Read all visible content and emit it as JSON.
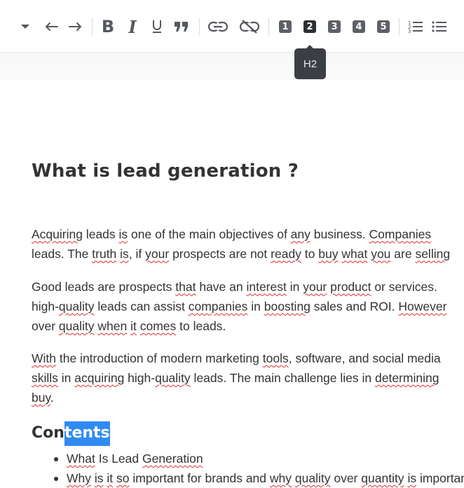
{
  "toolbar": {
    "buttons": [
      "dropdown-caret",
      "undo",
      "redo",
      "bold",
      "italic",
      "underline",
      "blockquote",
      "insert-link",
      "remove-link",
      "heading-1",
      "heading-2",
      "heading-3",
      "heading-4",
      "heading-5",
      "ordered-list",
      "bullet-list"
    ],
    "headings": [
      "1",
      "2",
      "3",
      "4",
      "5"
    ],
    "active_heading": "2",
    "tooltip": "H2"
  },
  "document": {
    "title": "What is lead generation ?",
    "p1_l1": [
      {
        "t": "Acquiring",
        "s": true
      },
      {
        "t": " leads "
      },
      {
        "t": "is",
        "s": true
      },
      {
        "t": " one of the main objectives of "
      },
      {
        "t": "any",
        "s": true
      },
      {
        "t": " business. "
      },
      {
        "t": "Companies",
        "s": true
      }
    ],
    "p1_l2": [
      {
        "t": "leads. The "
      },
      {
        "t": "truth",
        "s": true
      },
      {
        "t": " "
      },
      {
        "t": "is",
        "s": true
      },
      {
        "t": ", if "
      },
      {
        "t": "your",
        "s": true
      },
      {
        "t": " prospects are not "
      },
      {
        "t": "ready",
        "s": true
      },
      {
        "t": " to "
      },
      {
        "t": "buy",
        "s": true
      },
      {
        "t": " "
      },
      {
        "t": "what",
        "s": true
      },
      {
        "t": " "
      },
      {
        "t": "you",
        "s": true
      },
      {
        "t": " are "
      },
      {
        "t": "selling",
        "s": true
      }
    ],
    "p2_l1": [
      {
        "t": "Good leads are prospects "
      },
      {
        "t": "that",
        "s": true
      },
      {
        "t": " have an "
      },
      {
        "t": "interest",
        "s": true
      },
      {
        "t": " in "
      },
      {
        "t": "your",
        "s": true
      },
      {
        "t": " "
      },
      {
        "t": "product",
        "s": true
      },
      {
        "t": " or services."
      }
    ],
    "p2_l2": [
      {
        "t": "high-"
      },
      {
        "t": "quality",
        "s": true
      },
      {
        "t": " leads can assist "
      },
      {
        "t": "companies",
        "s": true
      },
      {
        "t": " in "
      },
      {
        "t": "boosting",
        "s": true
      },
      {
        "t": " sales and ROI. "
      },
      {
        "t": "However",
        "s": true
      }
    ],
    "p2_l3": [
      {
        "t": "over "
      },
      {
        "t": "quality",
        "s": true
      },
      {
        "t": " "
      },
      {
        "t": "when",
        "s": true
      },
      {
        "t": " "
      },
      {
        "t": "it",
        "s": true
      },
      {
        "t": " "
      },
      {
        "t": "comes",
        "s": true
      },
      {
        "t": " to leads."
      }
    ],
    "p3_l1": [
      {
        "t": "With",
        "s": true
      },
      {
        "t": " the introduction of modern marketing "
      },
      {
        "t": "tools",
        "s": true
      },
      {
        "t": ", software, and social media"
      }
    ],
    "p3_l2": [
      {
        "t": "skills",
        "s": true
      },
      {
        "t": " in "
      },
      {
        "t": "acquiring",
        "s": true
      },
      {
        "t": " high-"
      },
      {
        "t": "quality",
        "s": true
      },
      {
        "t": " leads. The main challenge lies in "
      },
      {
        "t": "determining",
        "s": true
      }
    ],
    "p3_l3": [
      {
        "t": "buy",
        "s": true
      },
      {
        "t": "."
      }
    ],
    "contents_unselected": "Con",
    "contents_selected": "tents",
    "toc_1": [
      {
        "t": "What",
        "s": true
      },
      {
        "t": " Is Lead "
      },
      {
        "t": "Generation",
        "s": true
      }
    ],
    "toc_2": [
      {
        "t": "Why",
        "s": true
      },
      {
        "t": " "
      },
      {
        "t": "is",
        "s": true
      },
      {
        "t": " "
      },
      {
        "t": "it",
        "s": true
      },
      {
        "t": " "
      },
      {
        "t": "so",
        "s": true
      },
      {
        "t": " important for brands and "
      },
      {
        "t": "why",
        "s": true
      },
      {
        "t": " "
      },
      {
        "t": "quality",
        "s": true
      },
      {
        "t": " over "
      },
      {
        "t": "quantity",
        "s": true
      },
      {
        "t": " "
      },
      {
        "t": "is",
        "s": true
      },
      {
        "t": " important"
      }
    ]
  }
}
